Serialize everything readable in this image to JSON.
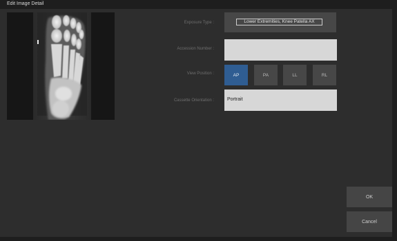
{
  "window": {
    "title": "Edit Image Detail"
  },
  "form": {
    "exposure_type_label": "Exposure Type :",
    "exposure_type_value": "Lower Extremities, Knee Patella AX",
    "accession_number_label": "Accession Number :",
    "accession_number_value": "",
    "view_position_label": "View Position :",
    "view_positions": [
      {
        "label": "AP",
        "selected": true
      },
      {
        "label": "PA",
        "selected": false
      },
      {
        "label": "LL",
        "selected": false
      },
      {
        "label": "RL",
        "selected": false
      }
    ],
    "cassette_orientation_label": "Cassette Orientation :",
    "cassette_orientation_value": "Portrait"
  },
  "actions": {
    "ok_label": "OK",
    "cancel_label": "Cancel"
  },
  "colors": {
    "background": "#2d2d2d",
    "selected_button": "#2f5d92",
    "button": "#474747",
    "input": "#d7d7d7"
  },
  "thumbnail": {
    "icon": "xray-foot-image"
  }
}
